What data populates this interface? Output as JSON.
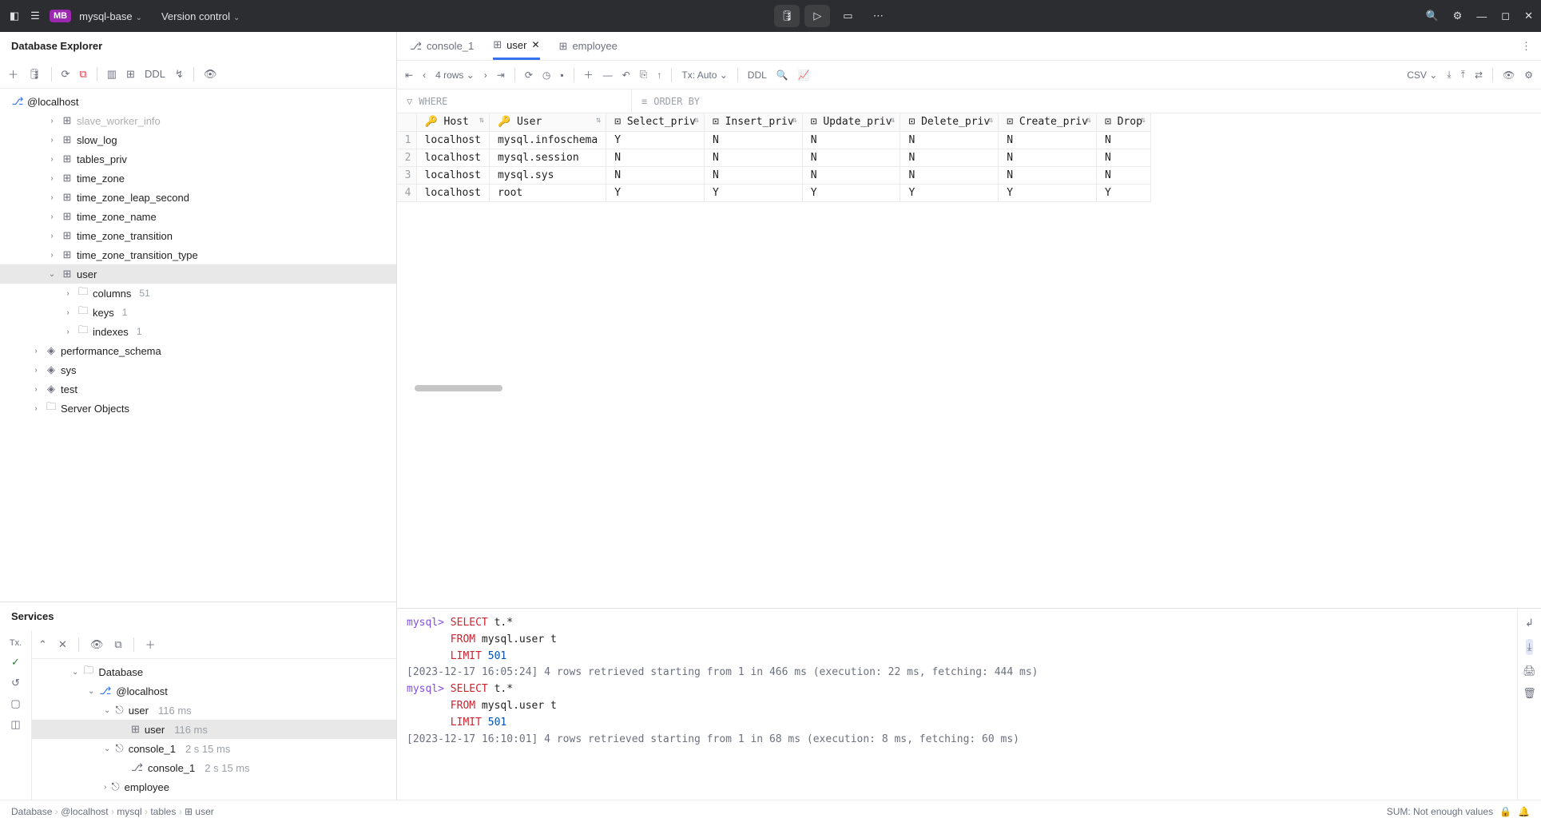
{
  "titlebar": {
    "proj_badge": "MB",
    "proj_name": "mysql-base",
    "vcs": "Version control"
  },
  "db_explorer": {
    "title": "Database Explorer",
    "ddl_btn": "DDL",
    "root": "@localhost",
    "tables": [
      "slave_worker_info",
      "slow_log",
      "tables_priv",
      "time_zone",
      "time_zone_leap_second",
      "time_zone_name",
      "time_zone_transition",
      "time_zone_transition_type",
      "user"
    ],
    "user_children": [
      {
        "label": "columns",
        "count": "51"
      },
      {
        "label": "keys",
        "count": "1"
      },
      {
        "label": "indexes",
        "count": "1"
      }
    ],
    "schemas": [
      "performance_schema",
      "sys",
      "test"
    ],
    "server_objects": "Server Objects"
  },
  "services": {
    "title": "Services",
    "tx_label": "Tx.",
    "root": "Database",
    "localhost": "@localhost",
    "items": [
      {
        "label": "user",
        "meta": "116 ms",
        "children": [
          {
            "label": "user",
            "meta": "116 ms"
          }
        ]
      },
      {
        "label": "console_1",
        "meta": "2 s 15 ms",
        "children": [
          {
            "label": "console_1",
            "meta": "2 s 15 ms"
          }
        ]
      },
      {
        "label": "employee",
        "meta": ""
      }
    ]
  },
  "tabs": [
    {
      "label": "console_1",
      "icon": "console"
    },
    {
      "label": "user",
      "icon": "table",
      "active": true,
      "closable": true
    },
    {
      "label": "employee",
      "icon": "table"
    }
  ],
  "grid_toolbar": {
    "rows": "4 rows",
    "tx": "Tx: Auto",
    "ddl": "DDL",
    "csv": "CSV"
  },
  "filters": {
    "where": "WHERE",
    "orderby": "ORDER BY"
  },
  "columns": [
    "Host",
    "User",
    "Select_priv",
    "Insert_priv",
    "Update_priv",
    "Delete_priv",
    "Create_priv",
    "Drop"
  ],
  "rows": [
    {
      "n": "1",
      "Host": "localhost",
      "User": "mysql.infoschema",
      "Select_priv": "Y",
      "Insert_priv": "N",
      "Update_priv": "N",
      "Delete_priv": "N",
      "Create_priv": "N",
      "Drop": "N"
    },
    {
      "n": "2",
      "Host": "localhost",
      "User": "mysql.session",
      "Select_priv": "N",
      "Insert_priv": "N",
      "Update_priv": "N",
      "Delete_priv": "N",
      "Create_priv": "N",
      "Drop": "N"
    },
    {
      "n": "3",
      "Host": "localhost",
      "User": "mysql.sys",
      "Select_priv": "N",
      "Insert_priv": "N",
      "Update_priv": "N",
      "Delete_priv": "N",
      "Create_priv": "N",
      "Drop": "N"
    },
    {
      "n": "4",
      "Host": "localhost",
      "User": "root",
      "Select_priv": "Y",
      "Insert_priv": "Y",
      "Update_priv": "Y",
      "Delete_priv": "Y",
      "Create_priv": "Y",
      "Drop": "Y"
    }
  ],
  "console": {
    "lines": [
      {
        "t": "prompt",
        "text": "mysql> "
      },
      {
        "t": "kw",
        "text": "SELECT"
      },
      {
        "t": "txt",
        "text": " t.*"
      },
      {
        "t": "br"
      },
      {
        "t": "pad"
      },
      {
        "t": "kw",
        "text": "FROM"
      },
      {
        "t": "txt",
        "text": " mysql.user t"
      },
      {
        "t": "br"
      },
      {
        "t": "pad"
      },
      {
        "t": "kw",
        "text": "LIMIT "
      },
      {
        "t": "num",
        "text": "501"
      },
      {
        "t": "br"
      },
      {
        "t": "gray",
        "text": "[2023-12-17 16:05:24] 4 rows retrieved starting from 1 in 466 ms (execution: 22 ms, fetching: 444 ms)"
      },
      {
        "t": "br"
      },
      {
        "t": "prompt",
        "text": "mysql> "
      },
      {
        "t": "kw",
        "text": "SELECT"
      },
      {
        "t": "txt",
        "text": " t.*"
      },
      {
        "t": "br"
      },
      {
        "t": "pad"
      },
      {
        "t": "kw",
        "text": "FROM"
      },
      {
        "t": "txt",
        "text": " mysql.user t"
      },
      {
        "t": "br"
      },
      {
        "t": "pad"
      },
      {
        "t": "kw",
        "text": "LIMIT "
      },
      {
        "t": "num",
        "text": "501"
      },
      {
        "t": "br"
      },
      {
        "t": "gray",
        "text": "[2023-12-17 16:10:01] 4 rows retrieved starting from 1 in 68 ms (execution: 8 ms, fetching: 60 ms)"
      }
    ]
  },
  "statusbar": {
    "crumbs": [
      "Database",
      "@localhost",
      "mysql",
      "tables",
      "user"
    ],
    "sum": "SUM: Not enough values"
  }
}
